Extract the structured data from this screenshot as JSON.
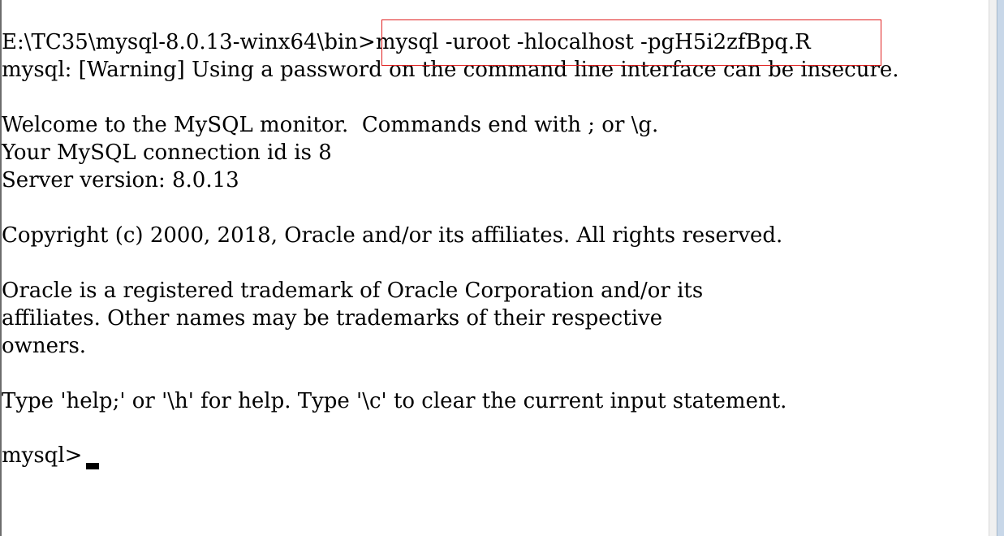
{
  "console": {
    "command_prefix": "E:\\TC35\\mysql-8.0.13-winx64\\bin>",
    "command_text": "mysql -uroot -hlocalhost -pgH5i2zfBpq.R",
    "lines": [
      "mysql: [Warning] Using a password on the command line interface can be insecure.",
      "",
      "Welcome to the MySQL monitor.  Commands end with ; or \\g.",
      "Your MySQL connection id is 8",
      "Server version: 8.0.13",
      "",
      "Copyright (c) 2000, 2018, Oracle and/or its affiliates. All rights reserved.",
      "",
      "Oracle is a registered trademark of Oracle Corporation and/or its",
      "affiliates. Other names may be trademarks of their respective",
      "owners.",
      "",
      "Type 'help;' or '\\h' for help. Type '\\c' to clear the current input statement."
    ],
    "prompt": "mysql> "
  },
  "colors": {
    "background": "#ffffff",
    "text": "#000000",
    "highlight_border": "#e02020"
  }
}
